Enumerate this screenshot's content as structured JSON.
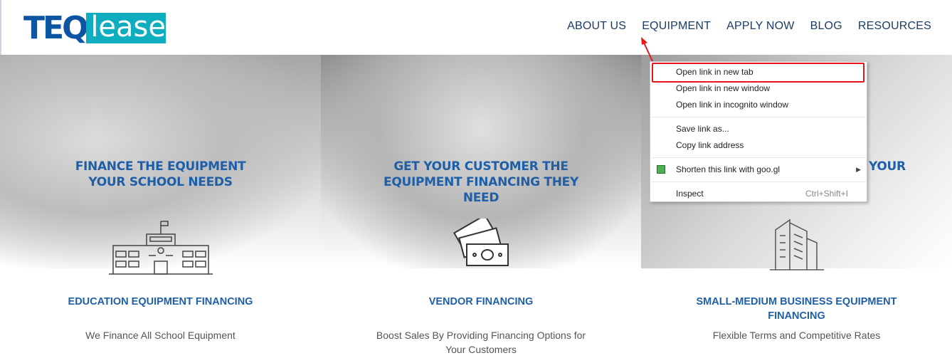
{
  "header": {
    "logo": {
      "part1": "TEQ",
      "part2": "lease"
    },
    "nav": [
      "ABOUT US",
      "EQUIPMENT",
      "APPLY NOW",
      "BLOG",
      "RESOURCES"
    ]
  },
  "panels": [
    {
      "heading": "FINANCE THE EQUIPMENT YOUR SCHOOL NEEDS",
      "icon": "school-building-icon",
      "title": "EDUCATION EQUIPMENT FINANCING",
      "desc": "We Finance All School Equipment"
    },
    {
      "heading": "GET YOUR CUSTOMER THE EQUIPMENT FINANCING THEY NEED",
      "icon": "money-bills-icon",
      "title": "VENDOR FINANCING",
      "desc": "Boost Sales By Providing Financing Options for Your Customers"
    },
    {
      "heading": "YOUR",
      "icon": "office-building-icon",
      "title": "SMALL-MEDIUM BUSINESS EQUIPMENT FINANCING",
      "desc": "Flexible Terms and Competitive Rates"
    }
  ],
  "context_menu": {
    "items": [
      "Open link in new tab",
      "Open link in new window",
      "Open link in incognito window",
      "Save link as...",
      "Copy link address",
      "Shorten this link with goo.gl",
      "Inspect"
    ],
    "inspect_shortcut": "Ctrl+Shift+I",
    "highlighted": "Open link in new tab",
    "highlight_color": "#e8161b"
  },
  "colors": {
    "brand_blue": "#0b55a3",
    "brand_teal": "#0eadc0",
    "heading_blue": "#1f5fa8"
  }
}
